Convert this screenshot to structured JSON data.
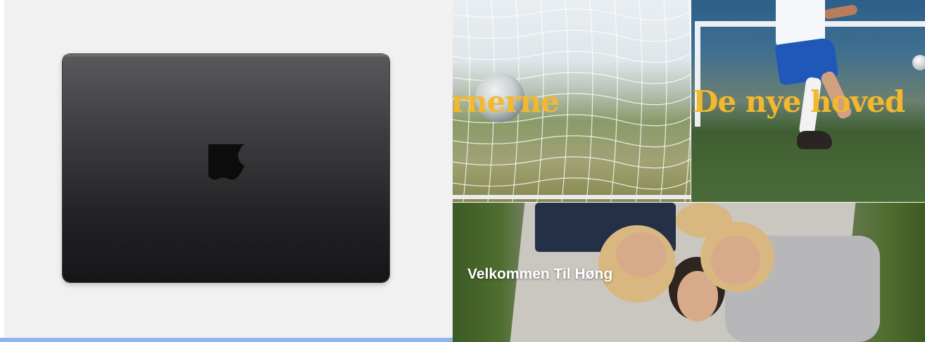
{
  "product": {
    "name": "MacBook Pro lid (space black)",
    "logo": "apple-logo-icon"
  },
  "mosaic": {
    "tile_left_headline": "rnerne",
    "tile_right_headline": "De nye hoved",
    "tile_bottom_caption": "Velkommen Til Høng"
  },
  "colors": {
    "headline": "#f2b82e",
    "accent_bar": "#8fb4f2",
    "panel_bg": "#f1f1f1"
  }
}
